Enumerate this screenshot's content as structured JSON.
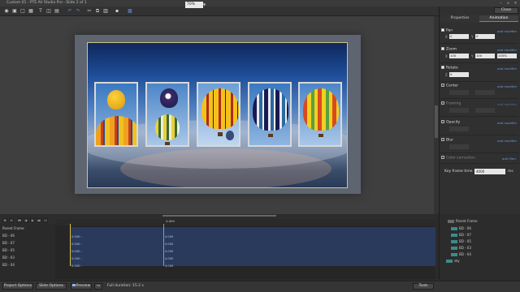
{
  "window": {
    "title": "Custom 01 - PTE AV Studio Pro - Slide 2 of 1"
  },
  "toolbar": {
    "zoom_value": "70%",
    "properties_label": "Properties",
    "animation_label": "Animation",
    "close_label": "Close"
  },
  "animation": {
    "pan_label": "Pan",
    "zoom_label": "Zoom",
    "rotate_label": "Rotate",
    "center_label": "Center",
    "framing_label": "Framing",
    "opacity_label": "Opacity",
    "blur_label": "Blur",
    "color_correction_label": "Color correction",
    "add_modifier_label": "add modifier",
    "add_filter_label": "add filter",
    "pan_x": "0",
    "pan_y": "0",
    "zoom_x": "100",
    "zoom_y": "100",
    "zoom_pct": "100%",
    "rotate_z": "0",
    "keyframe_time_label": "Key frame time",
    "keyframe_time_value": "4000",
    "keyframe_time_unit": "ms"
  },
  "timeline": {
    "ruler_mark": "4.000",
    "rows": [
      {
        "name": "Parent Frame",
        "v1": "",
        "v2": ""
      },
      {
        "name": "BD - 06",
        "v1": "0.000 ›",
        "v2": "4.000"
      },
      {
        "name": "BD - 07",
        "v1": "0.000 ›",
        "v2": "4.000"
      },
      {
        "name": "BD - 05",
        "v1": "0.000 ›",
        "v2": "4.000"
      },
      {
        "name": "BD - 03",
        "v1": "0.000 ›",
        "v2": "4.000"
      },
      {
        "name": "BD - 04",
        "v1": "0.000 ›",
        "v2": "4.000"
      }
    ]
  },
  "objects": {
    "items": [
      "Parent Frame",
      "BD - 06",
      "BD - 07",
      "BD - 05",
      "BD - 03",
      "BD - 04",
      "sky"
    ]
  },
  "bottom": {
    "project_options": "Project Options",
    "slide_options": "Slide Options",
    "preview": "Preview",
    "full_duration": "Full duration: 15.2 s",
    "tools": "Tools"
  },
  "colors": {
    "accent": "#5a88c8",
    "track": "#293a5c",
    "playhead": "#e0c040"
  }
}
